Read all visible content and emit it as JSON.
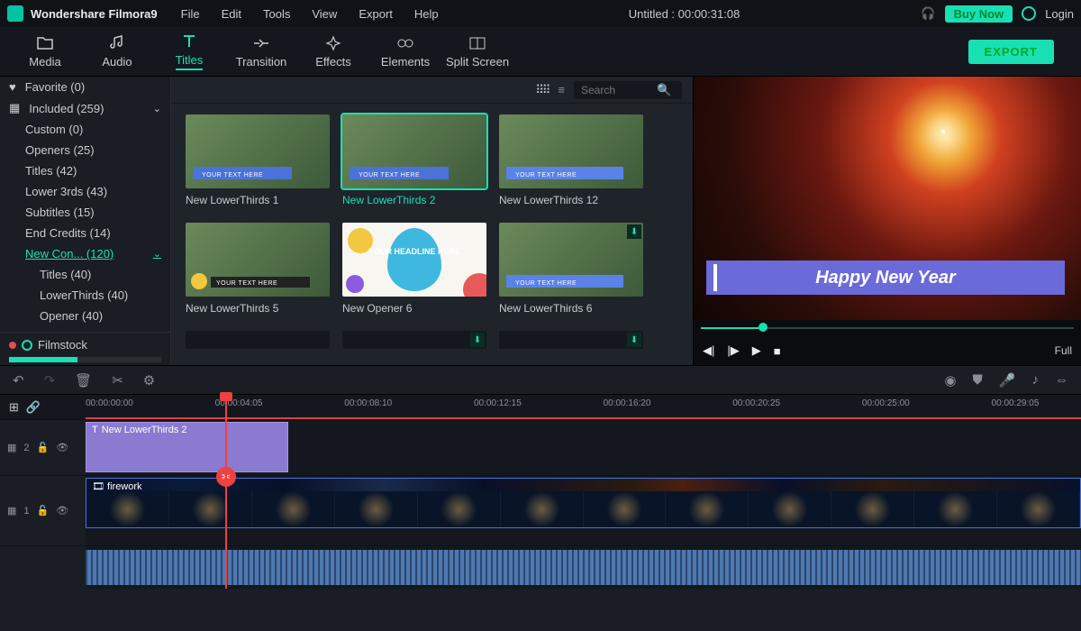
{
  "app": {
    "brand": "Wondershare Filmora9",
    "doc_title": "Untitled : 00:00:31:08",
    "login": "Login",
    "buynow": "Buy Now"
  },
  "menubar": [
    "File",
    "Edit",
    "Tools",
    "View",
    "Export",
    "Help"
  ],
  "tabs": {
    "items": [
      "Media",
      "Audio",
      "Titles",
      "Transition",
      "Effects",
      "Elements",
      "Split Screen"
    ],
    "export": "EXPORT"
  },
  "sidebar": {
    "favorite": "Favorite (0)",
    "included": "Included (259)",
    "cats": {
      "custom": "Custom (0)",
      "openers": "Openers (25)",
      "titles": "Titles (42)",
      "lower3rds": "Lower 3rds (43)",
      "subtitles": "Subtitles (15)",
      "endcredits": "End Credits (14)",
      "newcon": "New Con... (120)",
      "sub_titles": "Titles (40)",
      "sub_lowerthirds": "LowerThirds (40)",
      "sub_opener": "Opener (40)"
    },
    "filmstock": "Filmstock"
  },
  "browser": {
    "search_placeholder": "Search",
    "items": [
      {
        "name": "New LowerThirds 1",
        "txt": "YOUR TEXT HERE"
      },
      {
        "name": "New LowerThirds 2",
        "txt": "YOUR TEXT HERE"
      },
      {
        "name": "New LowerThirds 12",
        "txt": "YOUR TEXT HERE"
      },
      {
        "name": "New LowerThirds 5",
        "txt": "YOUR TEXT HERE"
      },
      {
        "name": "New Opener 6",
        "txt": "YOUR\nHEADLINE\nHERE"
      },
      {
        "name": "New LowerThirds 6",
        "txt": "YOUR TEXT HERE"
      }
    ]
  },
  "preview": {
    "title_overlay": "Happy New Year",
    "full": "Full"
  },
  "timeline": {
    "ticks": [
      "00:00:00:00",
      "00:00:04:05",
      "00:00:08:10",
      "00:00:12:15",
      "00:00:16:20",
      "00:00:20:25",
      "00:00:25:00",
      "00:00:29:05"
    ],
    "track2_label": "2",
    "track1_label": "1",
    "clip_title_name": "New LowerThirds 2",
    "clip_video_name": "firework"
  }
}
